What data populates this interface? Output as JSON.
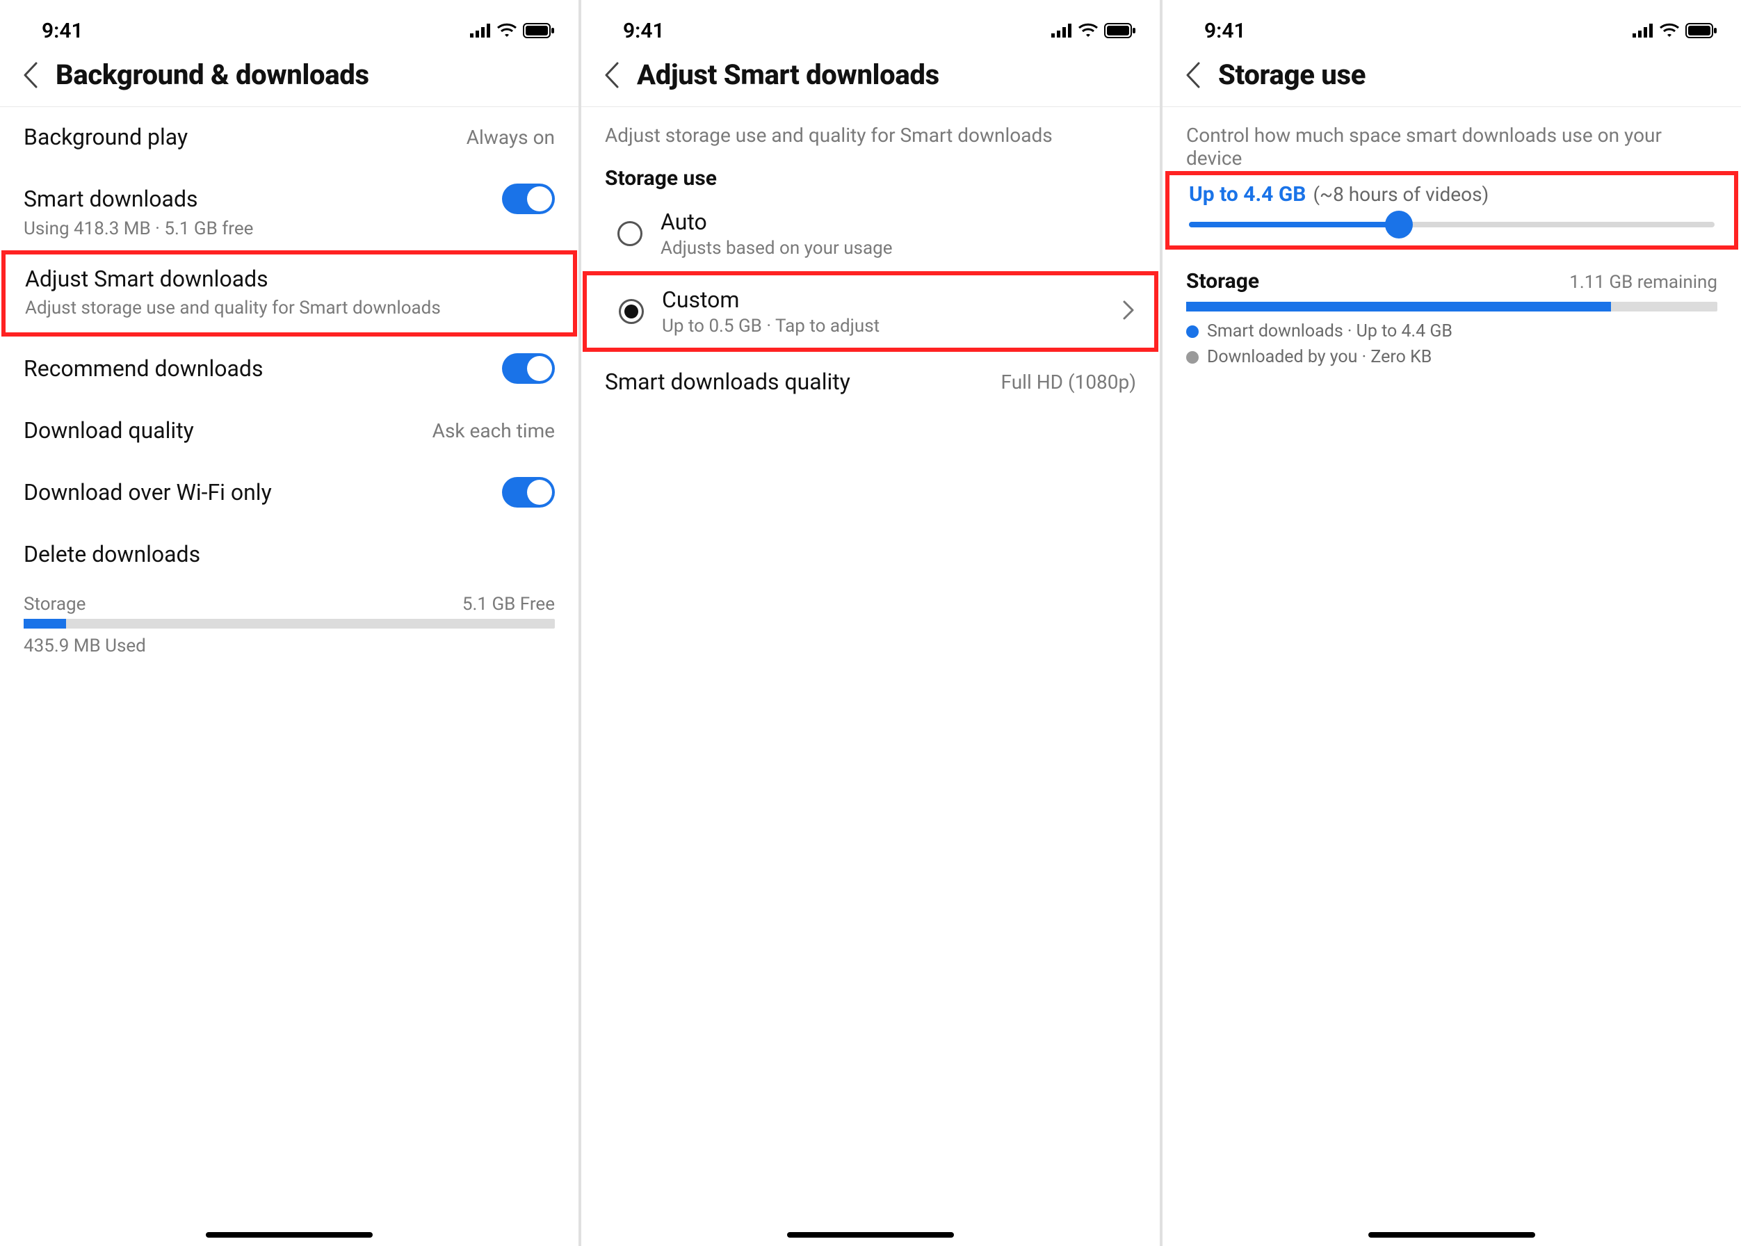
{
  "status": {
    "time": "9:41"
  },
  "panel1": {
    "title": "Background & downloads",
    "bgplay": {
      "label": "Background play",
      "value": "Always on"
    },
    "smart": {
      "label": "Smart downloads",
      "sub": "Using 418.3 MB · 5.1 GB free"
    },
    "adjust": {
      "label": "Adjust Smart downloads",
      "sub": "Adjust storage use and quality for Smart downloads"
    },
    "recommend": {
      "label": "Recommend downloads"
    },
    "dlquality": {
      "label": "Download quality",
      "value": "Ask each time"
    },
    "wifi": {
      "label": "Download over Wi-Fi only"
    },
    "delete": {
      "label": "Delete downloads"
    },
    "storage": {
      "label": "Storage",
      "free": "5.1 GB Free",
      "used": "435.9 MB Used"
    }
  },
  "panel2": {
    "title": "Adjust Smart downloads",
    "desc": "Adjust storage use and quality for Smart downloads",
    "section": "Storage use",
    "auto": {
      "label": "Auto",
      "sub": "Adjusts based on your usage"
    },
    "custom": {
      "label": "Custom",
      "sub": "Up to 0.5 GB · Tap to adjust"
    },
    "quality": {
      "label": "Smart downloads quality",
      "value": "Full HD (1080p)"
    }
  },
  "panel3": {
    "title": "Storage use",
    "desc": "Control how much space smart downloads use on your device",
    "slider": {
      "main": "Up to 4.4 GB",
      "approx": "(~8 hours of videos)"
    },
    "storage": {
      "label": "Storage",
      "remaining": "1.11 GB remaining"
    },
    "legend1": "Smart downloads · Up to 4.4 GB",
    "legend2": "Downloaded by you · Zero KB"
  }
}
